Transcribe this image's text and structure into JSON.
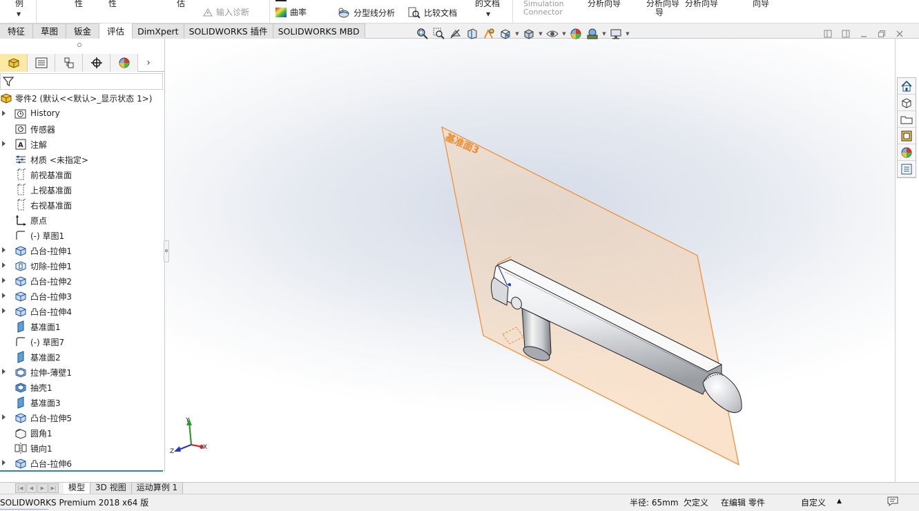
{
  "ribbon": {
    "cut_labels": [
      "例",
      "性",
      "性",
      "估",
      "的文档",
      "分析向导",
      "分析向导",
      "分析向导",
      "向导"
    ],
    "cut_wrap": "导",
    "input_diagnostics": "输入诊断",
    "curvature": "曲率",
    "parting_line_analysis": "分型线分析",
    "compare_documents": "比较文档",
    "simulation_connector_line1": "Simulation",
    "simulation_connector_line2": "Connector"
  },
  "tabs": [
    "特征",
    "草图",
    "钣金",
    "评估",
    "DimXpert",
    "SOLIDWORKS 插件",
    "SOLIDWORKS MBD"
  ],
  "active_tab": "评估",
  "feature_tree": {
    "root": "零件2 (默认<<默认>_显示状态 1>)",
    "items": [
      {
        "label": "History",
        "icon": "history-folder-icon",
        "expandable": true
      },
      {
        "label": "传感器",
        "icon": "sensor-icon",
        "expandable": false
      },
      {
        "label": "注解",
        "icon": "annotation-icon",
        "expandable": true
      },
      {
        "label": "材质 <未指定>",
        "icon": "material-icon",
        "expandable": false
      },
      {
        "label": "前视基准面",
        "icon": "plane-icon",
        "expandable": false
      },
      {
        "label": "上视基准面",
        "icon": "plane-icon",
        "expandable": false
      },
      {
        "label": "右视基准面",
        "icon": "plane-icon",
        "expandable": false
      },
      {
        "label": "原点",
        "icon": "origin-icon",
        "expandable": false
      },
      {
        "label": "(-) 草图1",
        "icon": "sketch-icon",
        "expandable": false
      },
      {
        "label": "凸台-拉伸1",
        "icon": "extrude-boss-icon",
        "expandable": true
      },
      {
        "label": "切除-拉伸1",
        "icon": "extrude-cut-icon",
        "expandable": true
      },
      {
        "label": "凸台-拉伸2",
        "icon": "extrude-boss-icon",
        "expandable": true
      },
      {
        "label": "凸台-拉伸3",
        "icon": "extrude-boss-icon",
        "expandable": true
      },
      {
        "label": "凸台-拉伸4",
        "icon": "extrude-boss-icon",
        "expandable": true
      },
      {
        "label": "基准面1",
        "icon": "ref-plane-icon",
        "expandable": false
      },
      {
        "label": "(-) 草图7",
        "icon": "sketch-icon",
        "expandable": false
      },
      {
        "label": "基准面2",
        "icon": "ref-plane-icon",
        "expandable": false
      },
      {
        "label": "拉伸-薄壁1",
        "icon": "thin-extrude-icon",
        "expandable": true
      },
      {
        "label": "抽壳1",
        "icon": "shell-icon",
        "expandable": false
      },
      {
        "label": "基准面3",
        "icon": "ref-plane-icon",
        "expandable": false
      },
      {
        "label": "凸台-拉伸5",
        "icon": "extrude-boss-icon",
        "expandable": true
      },
      {
        "label": "圆角1",
        "icon": "fillet-icon",
        "expandable": false
      },
      {
        "label": "镜向1",
        "icon": "mirror-icon",
        "expandable": false
      },
      {
        "label": "凸台-拉伸6",
        "icon": "extrude-boss-icon",
        "expandable": true
      }
    ]
  },
  "viewport": {
    "plane_label": "基准面3",
    "axis_x": "X",
    "axis_y": "Y",
    "axis_z": "Z"
  },
  "bottom_tabs": [
    "模型",
    "3D 视图",
    "运动算例 1"
  ],
  "active_bottom_tab": "模型",
  "status": {
    "app": "SOLIDWORKS Premium 2018 x64 版",
    "radius": "半径: 65mm",
    "under_defined": "欠定义",
    "editing": "在编辑 零件",
    "custom": "自定义"
  },
  "colors": {
    "accent": "#2b7fd6",
    "plane": "#f18a2c",
    "active_panel_tab": "#fde9a6"
  }
}
